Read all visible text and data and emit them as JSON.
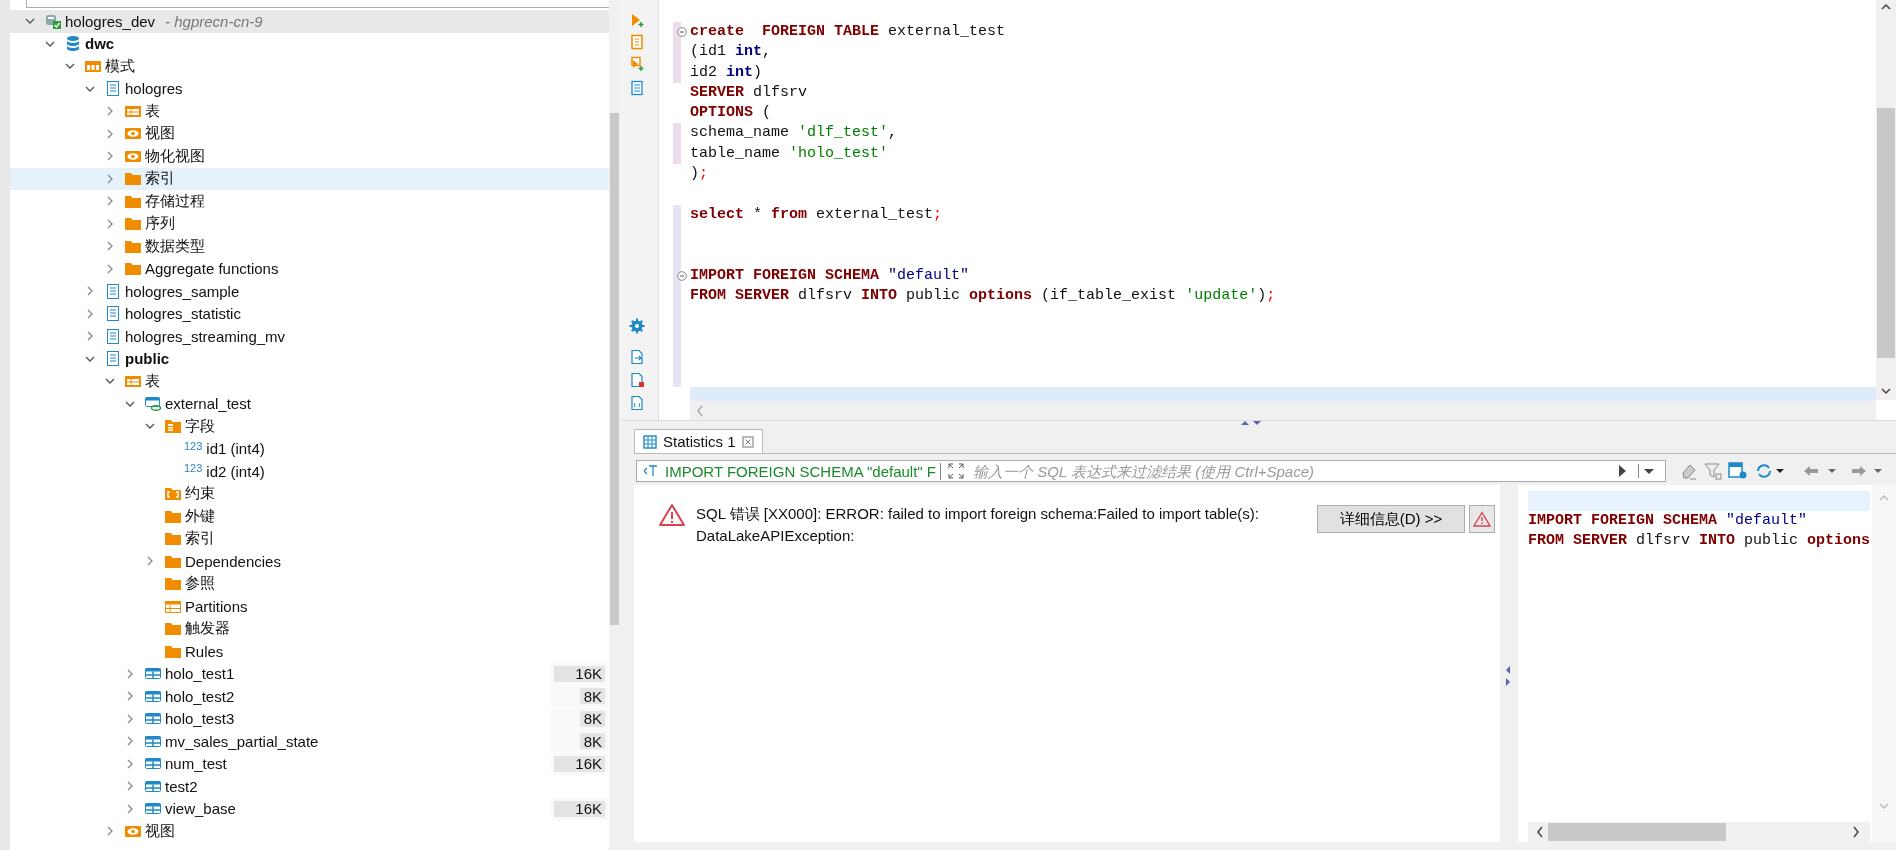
{
  "tree": {
    "nodes": [
      {
        "label": "hologres_dev",
        "detail": "- hgprecn-cn-9",
        "kind": "connection",
        "expanded": true,
        "selected": true,
        "children": [
          {
            "label": "dwc",
            "kind": "database",
            "expanded": true,
            "bold": true,
            "selected": false,
            "children": [
              {
                "label": "模式",
                "kind": "schema-folder",
                "expanded": true,
                "selected": false,
                "children": [
                  {
                    "label": "hologres",
                    "kind": "schema",
                    "expanded": true,
                    "selected": false,
                    "children": [
                      {
                        "label": "表",
                        "kind": "table-folder",
                        "expanded": false,
                        "selected": false
                      },
                      {
                        "label": "视图",
                        "kind": "view-folder",
                        "expanded": false,
                        "selected": false
                      },
                      {
                        "label": "物化视图",
                        "kind": "view-folder",
                        "expanded": false,
                        "selected": false
                      },
                      {
                        "label": "索引",
                        "kind": "folder",
                        "expanded": false,
                        "selected": false,
                        "hovered": true
                      },
                      {
                        "label": "存储过程",
                        "kind": "folder",
                        "expanded": false,
                        "selected": false
                      },
                      {
                        "label": "序列",
                        "kind": "folder",
                        "expanded": false,
                        "selected": false
                      },
                      {
                        "label": "数据类型",
                        "kind": "folder",
                        "expanded": false,
                        "selected": false
                      },
                      {
                        "label": "Aggregate functions",
                        "kind": "folder",
                        "expanded": false,
                        "selected": false
                      }
                    ]
                  },
                  {
                    "label": "hologres_sample",
                    "kind": "schema",
                    "expanded": false,
                    "selected": false
                  },
                  {
                    "label": "hologres_statistic",
                    "kind": "schema",
                    "expanded": false,
                    "selected": false
                  },
                  {
                    "label": "hologres_streaming_mv",
                    "kind": "schema",
                    "expanded": false,
                    "selected": false
                  },
                  {
                    "label": "public",
                    "kind": "schema",
                    "expanded": true,
                    "bold": true,
                    "selected": false,
                    "children": [
                      {
                        "label": "表",
                        "kind": "table-folder",
                        "expanded": true,
                        "selected": false,
                        "children": [
                          {
                            "label": "external_test",
                            "kind": "external-table",
                            "expanded": true,
                            "selected": false,
                            "children": [
                              {
                                "label": "字段",
                                "kind": "column-folder",
                                "expanded": true,
                                "selected": false,
                                "children": [
                                  {
                                    "label": "id1 (int4)",
                                    "glyph": "123",
                                    "kind": "column",
                                    "selected": false
                                  },
                                  {
                                    "label": "id2 (int4)",
                                    "glyph": "123",
                                    "kind": "column",
                                    "selected": false
                                  }
                                ]
                              },
                              {
                                "label": "约束",
                                "kind": "constraint-folder",
                                "selected": false
                              },
                              {
                                "label": "外键",
                                "kind": "folder",
                                "selected": false
                              },
                              {
                                "label": "索引",
                                "kind": "folder",
                                "selected": false
                              },
                              {
                                "label": "Dependencies",
                                "kind": "folder",
                                "expanded": false,
                                "selected": false
                              },
                              {
                                "label": "参照",
                                "kind": "folder",
                                "selected": false
                              },
                              {
                                "label": "Partitions",
                                "kind": "partition-folder",
                                "selected": false
                              },
                              {
                                "label": "触发器",
                                "kind": "folder",
                                "selected": false
                              },
                              {
                                "label": "Rules",
                                "kind": "folder",
                                "selected": false
                              }
                            ]
                          },
                          {
                            "label": "holo_test1",
                            "kind": "table",
                            "expanded": false,
                            "selected": false,
                            "size": "16K",
                            "level": 1
                          },
                          {
                            "label": "holo_test2",
                            "kind": "table",
                            "expanded": false,
                            "selected": false,
                            "size": "8K",
                            "level": 0.5
                          },
                          {
                            "label": "holo_test3",
                            "kind": "table",
                            "expanded": false,
                            "selected": false,
                            "size": "8K",
                            "level": 0.5
                          },
                          {
                            "label": "mv_sales_partial_state",
                            "kind": "table",
                            "expanded": false,
                            "selected": false,
                            "size": "8K",
                            "level": 0.5
                          },
                          {
                            "label": "num_test",
                            "kind": "table",
                            "expanded": false,
                            "selected": false,
                            "size": "16K",
                            "level": 1
                          },
                          {
                            "label": "test2",
                            "kind": "table",
                            "expanded": false,
                            "selected": false
                          },
                          {
                            "label": "view_base",
                            "kind": "table",
                            "expanded": false,
                            "selected": false,
                            "size": "16K",
                            "level": 1
                          }
                        ]
                      },
                      {
                        "label": "视图",
                        "kind": "view-folder",
                        "expanded": false,
                        "selected": false
                      }
                    ]
                  }
                ]
              }
            ]
          }
        ]
      }
    ]
  },
  "editor": {
    "lines": [
      {
        "fold": true,
        "modified": true,
        "added": false,
        "current": false,
        "tokens": [
          {
            "text": "create",
            "kind": "keyword"
          },
          {
            "text": "  FOREIGN TABLE",
            "kind": "keyword"
          },
          {
            "text": " external_test",
            "kind": "plain"
          }
        ]
      },
      {
        "fold": false,
        "modified": true,
        "added": false,
        "current": false,
        "tokens": [
          {
            "text": "(id1 ",
            "kind": "plain"
          },
          {
            "text": "int",
            "kind": "type"
          },
          {
            "text": ",",
            "kind": "plain"
          }
        ]
      },
      {
        "fold": false,
        "modified": true,
        "added": false,
        "current": false,
        "tokens": [
          {
            "text": "id2 ",
            "kind": "plain"
          },
          {
            "text": "int",
            "kind": "type"
          },
          {
            "text": ")",
            "kind": "plain"
          }
        ]
      },
      {
        "fold": false,
        "modified": false,
        "added": false,
        "current": false,
        "tokens": [
          {
            "text": "SERVER",
            "kind": "keyword"
          },
          {
            "text": " dlfsrv",
            "kind": "plain"
          }
        ]
      },
      {
        "fold": false,
        "modified": false,
        "added": false,
        "current": false,
        "tokens": [
          {
            "text": "OPTIONS",
            "kind": "keyword"
          },
          {
            "text": " (",
            "kind": "plain"
          }
        ]
      },
      {
        "fold": false,
        "modified": true,
        "added": false,
        "current": false,
        "tokens": [
          {
            "text": "schema_name ",
            "kind": "plain"
          },
          {
            "text": "'dlf_test'",
            "kind": "string"
          },
          {
            "text": ",",
            "kind": "plain"
          }
        ]
      },
      {
        "fold": false,
        "modified": true,
        "added": false,
        "current": false,
        "tokens": [
          {
            "text": "table_name ",
            "kind": "plain"
          },
          {
            "text": "'holo_test'",
            "kind": "string"
          }
        ]
      },
      {
        "fold": false,
        "modified": false,
        "added": false,
        "current": false,
        "tokens": [
          {
            "text": ")",
            "kind": "plain"
          },
          {
            "text": ";",
            "kind": "punct"
          }
        ]
      },
      {
        "fold": false,
        "modified": false,
        "added": false,
        "current": false
      },
      {
        "fold": false,
        "modified": false,
        "added": true,
        "current": false,
        "tokens": [
          {
            "text": "select",
            "kind": "keyword"
          },
          {
            "text": " * ",
            "kind": "plain"
          },
          {
            "text": "from",
            "kind": "keyword"
          },
          {
            "text": " external_test",
            "kind": "plain"
          },
          {
            "text": ";",
            "kind": "punct"
          }
        ]
      },
      {
        "fold": false,
        "modified": false,
        "added": true,
        "current": false
      },
      {
        "fold": false,
        "modified": false,
        "added": true,
        "current": false
      },
      {
        "fold": true,
        "modified": false,
        "added": true,
        "current": false,
        "tokens": [
          {
            "text": "IMPORT FOREIGN SCHEMA",
            "kind": "keyword"
          },
          {
            "text": " \"default\"",
            "kind": "ident"
          }
        ]
      },
      {
        "fold": false,
        "modified": false,
        "added": true,
        "current": false,
        "tokens": [
          {
            "text": "FROM SERVER",
            "kind": "keyword"
          },
          {
            "text": " dlfsrv ",
            "kind": "plain"
          },
          {
            "text": "INTO",
            "kind": "keyword"
          },
          {
            "text": " public ",
            "kind": "plain"
          },
          {
            "text": "options",
            "kind": "keyword"
          },
          {
            "text": " (if_table_exist ",
            "kind": "plain"
          },
          {
            "text": "'update'",
            "kind": "string"
          },
          {
            "text": ")",
            "kind": "plain"
          },
          {
            "text": ";",
            "kind": "punct"
          }
        ]
      },
      {
        "fold": false,
        "modified": false,
        "added": true,
        "current": false
      },
      {
        "fold": false,
        "modified": false,
        "added": true,
        "current": false
      },
      {
        "fold": false,
        "modified": false,
        "added": true,
        "current": false
      },
      {
        "fold": false,
        "modified": false,
        "added": true,
        "current": false
      },
      {
        "fold": false,
        "modified": false,
        "added": false,
        "current": true
      }
    ]
  },
  "results": {
    "tabs": [
      {
        "label": "Statistics 1",
        "selected": true
      }
    ],
    "filter": {
      "query": "IMPORT FOREIGN SCHEMA \"default\" F",
      "placeholder": "输入一个 SQL 表达式来过滤结果 (使用 Ctrl+Space)"
    },
    "error": {
      "message_lines": [
        "SQL 错误 [XX000]: ERROR: failed to import foreign schema:Failed to import table(s):",
        "DataLakeAPIException:"
      ]
    },
    "details_button": "详细信息(D) >>",
    "preview": {
      "lines": [
        {
          "current": true
        },
        {
          "current": false,
          "tokens": [
            {
              "text": "IMPORT FOREIGN SCHEMA",
              "kind": "keyword"
            },
            {
              "text": " \"default\"",
              "kind": "ident"
            }
          ]
        },
        {
          "current": false,
          "tokens": [
            {
              "text": "FROM SERVER",
              "kind": "keyword"
            },
            {
              "text": " dlfsrv ",
              "kind": "plain"
            },
            {
              "text": "INTO",
              "kind": "keyword"
            },
            {
              "text": " public ",
              "kind": "plain"
            },
            {
              "text": "options",
              "kind": "keyword"
            }
          ]
        }
      ]
    }
  }
}
